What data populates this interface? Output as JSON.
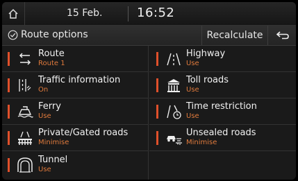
{
  "status": {
    "date": "15 Feb.",
    "time": "16:52"
  },
  "header": {
    "title": "Route options",
    "recalculate_label": "Recalculate"
  },
  "options": [
    {
      "label": "Route",
      "value": "Route 1",
      "icon": "route-icon"
    },
    {
      "label": "Highway",
      "value": "Use",
      "icon": "highway-icon"
    },
    {
      "label": "Traffic information",
      "value": "On",
      "icon": "traffic-icon"
    },
    {
      "label": "Toll roads",
      "value": "Use",
      "icon": "toll-roads-icon"
    },
    {
      "label": "Ferry",
      "value": "Use",
      "icon": "ferry-icon"
    },
    {
      "label": "Time restriction",
      "value": "Use",
      "icon": "time-restriction-icon"
    },
    {
      "label": "Private/Gated roads",
      "value": "Minimise",
      "icon": "gated-roads-icon"
    },
    {
      "label": "Unsealed roads",
      "value": "Minimise",
      "icon": "unsealed-roads-icon"
    },
    {
      "label": "Tunnel",
      "value": "Use",
      "icon": "tunnel-icon"
    }
  ],
  "colors": {
    "accent": "#e0502b",
    "value_text": "#e07a3c"
  }
}
